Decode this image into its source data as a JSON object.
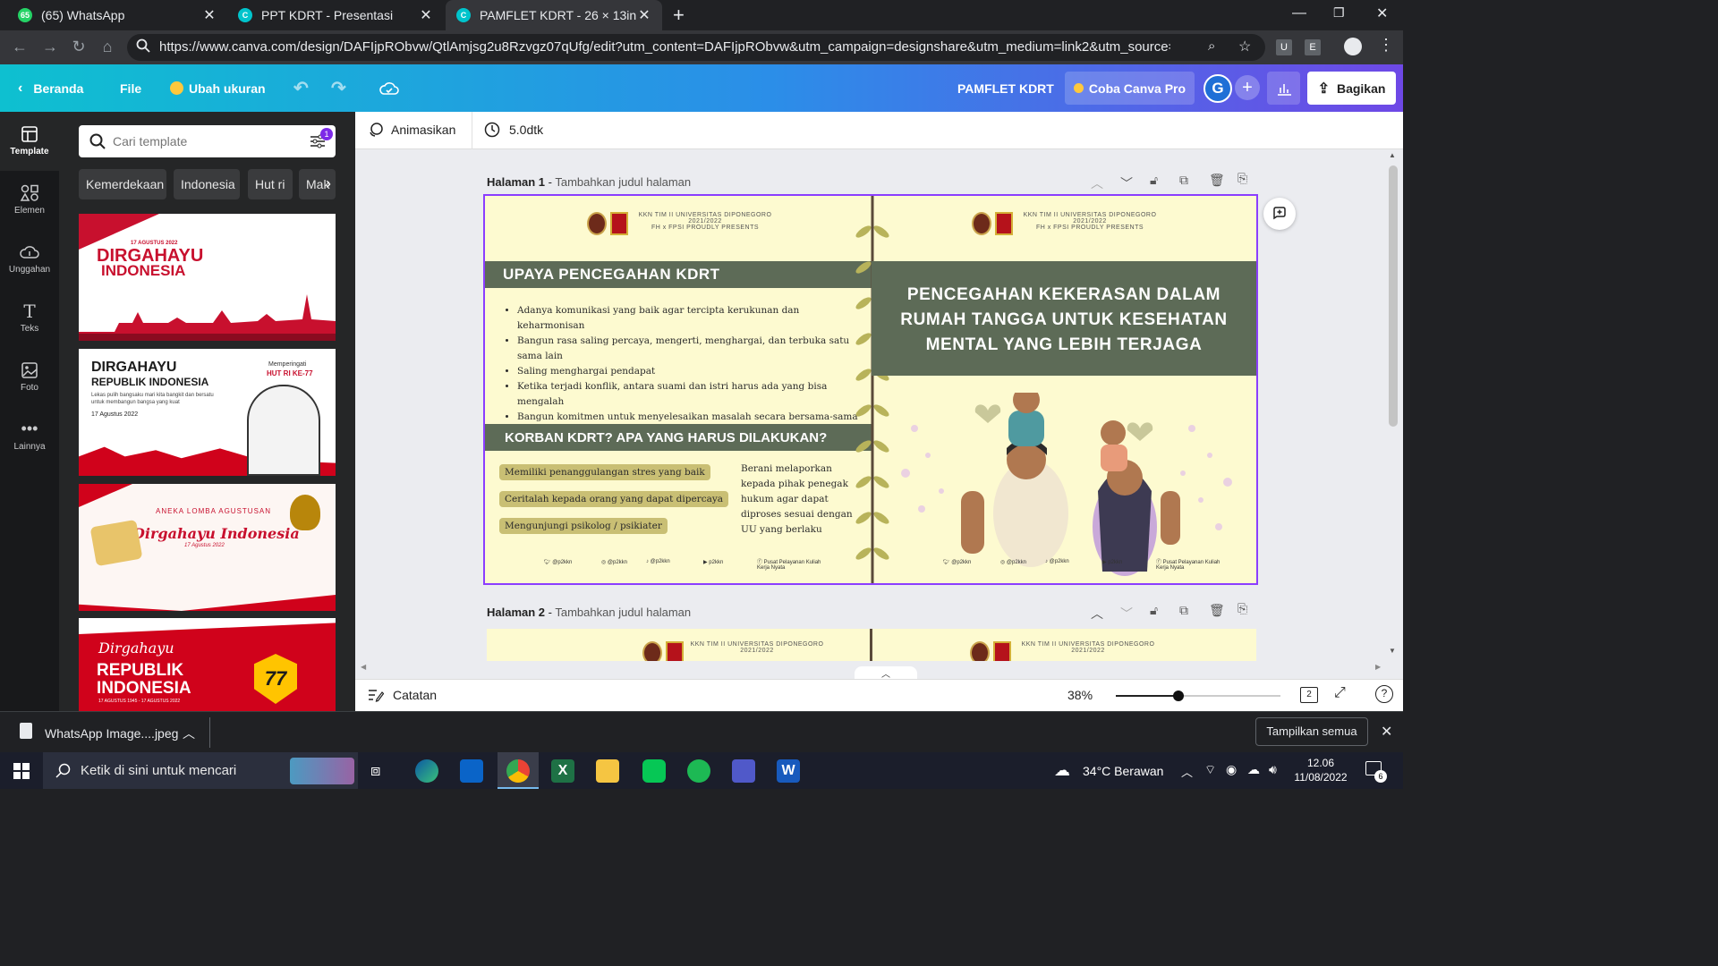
{
  "browser": {
    "tabs": [
      {
        "title": "(65) WhatsApp",
        "icon": "whatsapp-icon",
        "badge": "65"
      },
      {
        "title": "PPT KDRT - Presentasi",
        "icon": "canva-icon"
      },
      {
        "title": "PAMFLET KDRT - 26 × 13in",
        "icon": "canva-icon"
      }
    ],
    "url": "https://www.canva.com/design/DAFIjpRObvw/QtlAmjsg2u8Rzvgz07qUfg/edit?utm_content=DAFIjpRObvw&utm_campaign=designshare&utm_medium=link2&utm_source=sharebutt...",
    "ext1": "U",
    "ext2": "E"
  },
  "canva_header": {
    "home": "Beranda",
    "file": "File",
    "resize": "Ubah ukuran",
    "doc_title": "PAMFLET KDRT",
    "pro": "Coba Canva Pro",
    "avatar": "G",
    "share": "Bagikan"
  },
  "rail": [
    {
      "label": "Template",
      "icon": "template-icon"
    },
    {
      "label": "Elemen",
      "icon": "elements-icon"
    },
    {
      "label": "Unggahan",
      "icon": "upload-icon"
    },
    {
      "label": "Teks",
      "icon": "text-icon"
    },
    {
      "label": "Foto",
      "icon": "photo-icon"
    },
    {
      "label": "Lainnya",
      "icon": "more-icon"
    }
  ],
  "panel": {
    "search_placeholder": "Cari template",
    "filter_badge": "1",
    "chips": [
      "Kemerdekaan",
      "Indonesia",
      "Hut ri",
      "Mak"
    ],
    "thumbs": [
      {
        "small": "17 AGUSTUS 2022",
        "line1": "DIRGAHAYU",
        "line2": "INDONESIA"
      },
      {
        "line1": "DIRGAHAYU",
        "line2": "REPUBLIK INDONESIA",
        "desc": "Lekas pulih bangsaku mari kita bangkit dan bersatu untuk membangun bangsa yang kuat",
        "date": "17 Agustus 2022",
        "right1": "Memperingati",
        "right2": "HUT RI KE-77"
      },
      {
        "small": "ANEKA LOMBA AGUSTUSAN",
        "line1": "Dirgahayu Indonesia",
        "date": "17 Agustus 2022"
      },
      {
        "line1": "Dirgahayu",
        "line2": "REPUBLIK",
        "line3": "INDONESIA",
        "num": "77",
        "small": "17 AGUSTUS 1945 - 17 AGUSTUS 2022"
      }
    ]
  },
  "editor": {
    "animate": "Animasikan",
    "duration": "5.0dtk",
    "page1": {
      "label": "Halaman 1",
      "sub": "Tambahkan judul halaman"
    },
    "page2": {
      "label": "Halaman 2",
      "sub": "Tambahkan judul halaman"
    },
    "notes": "Catatan",
    "zoom": "38%",
    "zoom_fraction": 0.38,
    "page_count": "2"
  },
  "slide": {
    "header1": "KKN TIM II UNIVERSITAS DIPONEGORO",
    "header2": "2021/2022",
    "header3": "FH x FPSI PROUDLY PRESENTS",
    "left_title": "UPAYA PENCEGAHAN KDRT",
    "bullets": [
      "Adanya komunikasi yang baik agar tercipta kerukunan dan keharmonisan",
      "Bangun rasa saling percaya, mengerti, menghargai, dan terbuka satu sama lain",
      "Saling menghargai pendapat",
      "Ketika terjadi konflik, antara suami dan istri harus ada yang bisa mengalah",
      "Bangun komitmen untuk menyelesaikan masalah secara bersama-sama"
    ],
    "second_title": "KORBAN KDRT? APA YANG HARUS DILAKUKAN?",
    "pills": [
      "Memiliki penanggulangan stres yang baik",
      "Ceritalah kepada orang yang dapat dipercaya",
      "Mengunjungi psikolog / psikiater"
    ],
    "right_note": "Berani melaporkan kepada pihak penegak hukum agar dapat diproses sesuai dengan UU yang berlaku",
    "right_title": "PENCEGAHAN KEKERASAN DALAM RUMAH TANGGA UNTUK KESEHATAN MENTAL YANG LEBIH TERJAGA",
    "socials": [
      "@p2kkn",
      "@p2kkn",
      "@p2kkn",
      "p2kkn",
      "Pusat Pelayanan Kuliah Kerja Nyata"
    ]
  },
  "download": {
    "file": "WhatsApp Image....jpeg",
    "show_all": "Tampilkan semua"
  },
  "taskbar": {
    "search": "Ketik di sini untuk mencari",
    "weather": "34°C  Berawan",
    "time": "12.06",
    "date": "11/08/2022",
    "notif": "6"
  },
  "colors": {
    "accent": "#8b3dff",
    "slide_bg": "#fdfad0",
    "slide_green": "#5d6b57",
    "pill": "#c9bf74"
  }
}
